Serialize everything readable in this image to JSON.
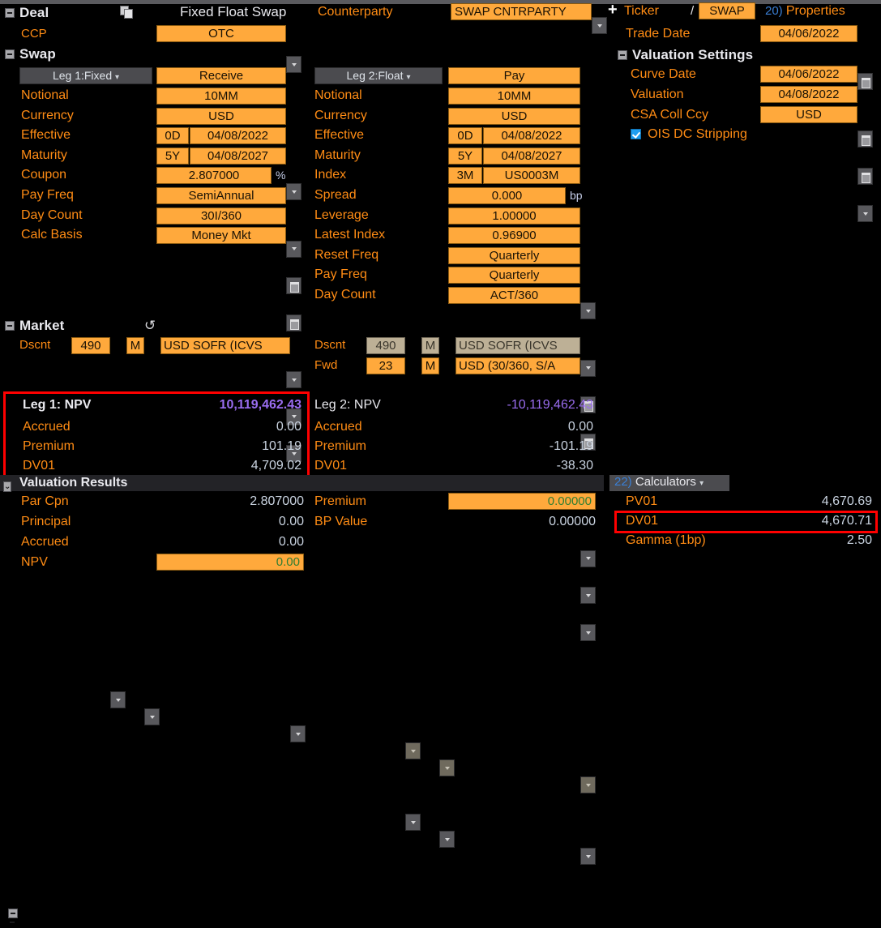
{
  "header": {
    "deal_section": "Deal",
    "copy_icon": "copy-icon",
    "deal_type": "Fixed Float Swap",
    "counterparty_label": "Counterparty",
    "counterparty_value": "SWAP CNTRPARTY",
    "plus": "+",
    "ticker_label": "Ticker",
    "slash": "/",
    "ticker_value": "SWAP",
    "properties_num": "20)",
    "properties_label": "Properties",
    "ccp_label": "CCP",
    "ccp_value": "OTC",
    "swap_section": "Swap",
    "trade_date_label": "Trade Date",
    "trade_date_value": "04/06/2022"
  },
  "valuation_settings": {
    "title": "Valuation Settings",
    "curve_date_label": "Curve Date",
    "curve_date_value": "04/06/2022",
    "valuation_label": "Valuation",
    "valuation_value": "04/08/2022",
    "csa_label": "CSA Coll Ccy",
    "csa_value": "USD",
    "ois_label": "OIS DC Stripping",
    "ois_checked": true
  },
  "leg1": {
    "tab": "Leg 1:Fixed",
    "direction": "Receive",
    "rows": [
      {
        "label": "Notional",
        "value": "10MM",
        "kind": "plain"
      },
      {
        "label": "Currency",
        "value": "USD",
        "kind": "drop"
      },
      {
        "label": "Effective",
        "tenor": "0D",
        "value": "04/08/2022",
        "kind": "date"
      },
      {
        "label": "Maturity",
        "tenor": "5Y",
        "value": "04/08/2027",
        "kind": "date"
      },
      {
        "label": "Coupon",
        "value": "2.807000",
        "unit": "%",
        "kind": "unit"
      },
      {
        "label": "Pay Freq",
        "value": "SemiAnnual",
        "kind": "drop"
      },
      {
        "label": "Day Count",
        "value": "30I/360",
        "kind": "drop"
      },
      {
        "label": "Calc Basis",
        "value": "Money Mkt",
        "kind": "drop"
      }
    ]
  },
  "leg2": {
    "tab": "Leg 2:Float",
    "direction": "Pay",
    "rows": [
      {
        "label": "Notional",
        "value": "10MM",
        "kind": "plain"
      },
      {
        "label": "Currency",
        "value": "USD",
        "kind": "drop"
      },
      {
        "label": "Effective",
        "tenor": "0D",
        "value": "04/08/2022",
        "kind": "date"
      },
      {
        "label": "Maturity",
        "tenor": "5Y",
        "value": "04/08/2027",
        "kind": "date"
      },
      {
        "label": "Index",
        "tenor": "3M",
        "value": "US0003M",
        "kind": "index"
      },
      {
        "label": "Spread",
        "value": "0.000",
        "unit": "bp",
        "kind": "unit"
      },
      {
        "label": "Leverage",
        "value": "1.00000",
        "kind": "plain"
      },
      {
        "label": "Latest Index",
        "value": "0.96900",
        "kind": "plain"
      },
      {
        "label": "Reset Freq",
        "value": "Quarterly",
        "kind": "drop"
      },
      {
        "label": "Pay Freq",
        "value": "Quarterly",
        "kind": "drop"
      },
      {
        "label": "Day Count",
        "value": "ACT/360",
        "kind": "drop"
      }
    ]
  },
  "market": {
    "title": "Market",
    "refresh_icon": "refresh-icon",
    "left": {
      "label": "Dscnt",
      "num": "490",
      "period": "M",
      "curve": "USD SOFR       (ICVS"
    },
    "right_dscnt": {
      "label": "Dscnt",
      "num": "490",
      "period": "M",
      "curve": "USD SOFR       (ICVS"
    },
    "right_fwd": {
      "label": "Fwd",
      "num": "23",
      "period": "M",
      "curve": "USD (30/360, S/A"
    }
  },
  "leg1_results": {
    "title": "Leg 1: NPV",
    "npv": "10,119,462.43",
    "rows": [
      {
        "label": "Accrued",
        "value": "0.00"
      },
      {
        "label": "Premium",
        "value": "101.19"
      },
      {
        "label": "DV01",
        "value": "4,709.02"
      }
    ]
  },
  "leg2_results": {
    "title": "Leg 2: NPV",
    "npv": "-10,119,462.43",
    "rows": [
      {
        "label": "Accrued",
        "value": "0.00"
      },
      {
        "label": "Premium",
        "value": "-101.19"
      },
      {
        "label": "DV01",
        "value": "-38.30"
      }
    ]
  },
  "valuation_results": {
    "title": "Valuation Results",
    "left_rows": [
      {
        "label": "Par Cpn",
        "value": "2.807000",
        "editable": false
      },
      {
        "label": "Principal",
        "value": "0.00",
        "editable": false
      },
      {
        "label": "Accrued",
        "value": "0.00",
        "editable": false
      },
      {
        "label": "NPV",
        "value": "0.00",
        "editable": true
      }
    ],
    "right_rows": [
      {
        "label": "Premium",
        "value": "0.00000",
        "editable": true
      },
      {
        "label": "BP Value",
        "value": "0.00000",
        "editable": false
      }
    ]
  },
  "calculators": {
    "num": "22)",
    "title": "Calculators",
    "rows": [
      {
        "label": "PV01",
        "value": "4,670.69"
      },
      {
        "label": "DV01",
        "value": "4,670.71"
      },
      {
        "label": "Gamma (1bp)",
        "value": "2.50"
      }
    ]
  },
  "colors": {
    "field_bg": "#ffa93c",
    "label": "#ff8c14",
    "npv_violet": "#9a6df0",
    "highlight_box": "#ff0000"
  }
}
